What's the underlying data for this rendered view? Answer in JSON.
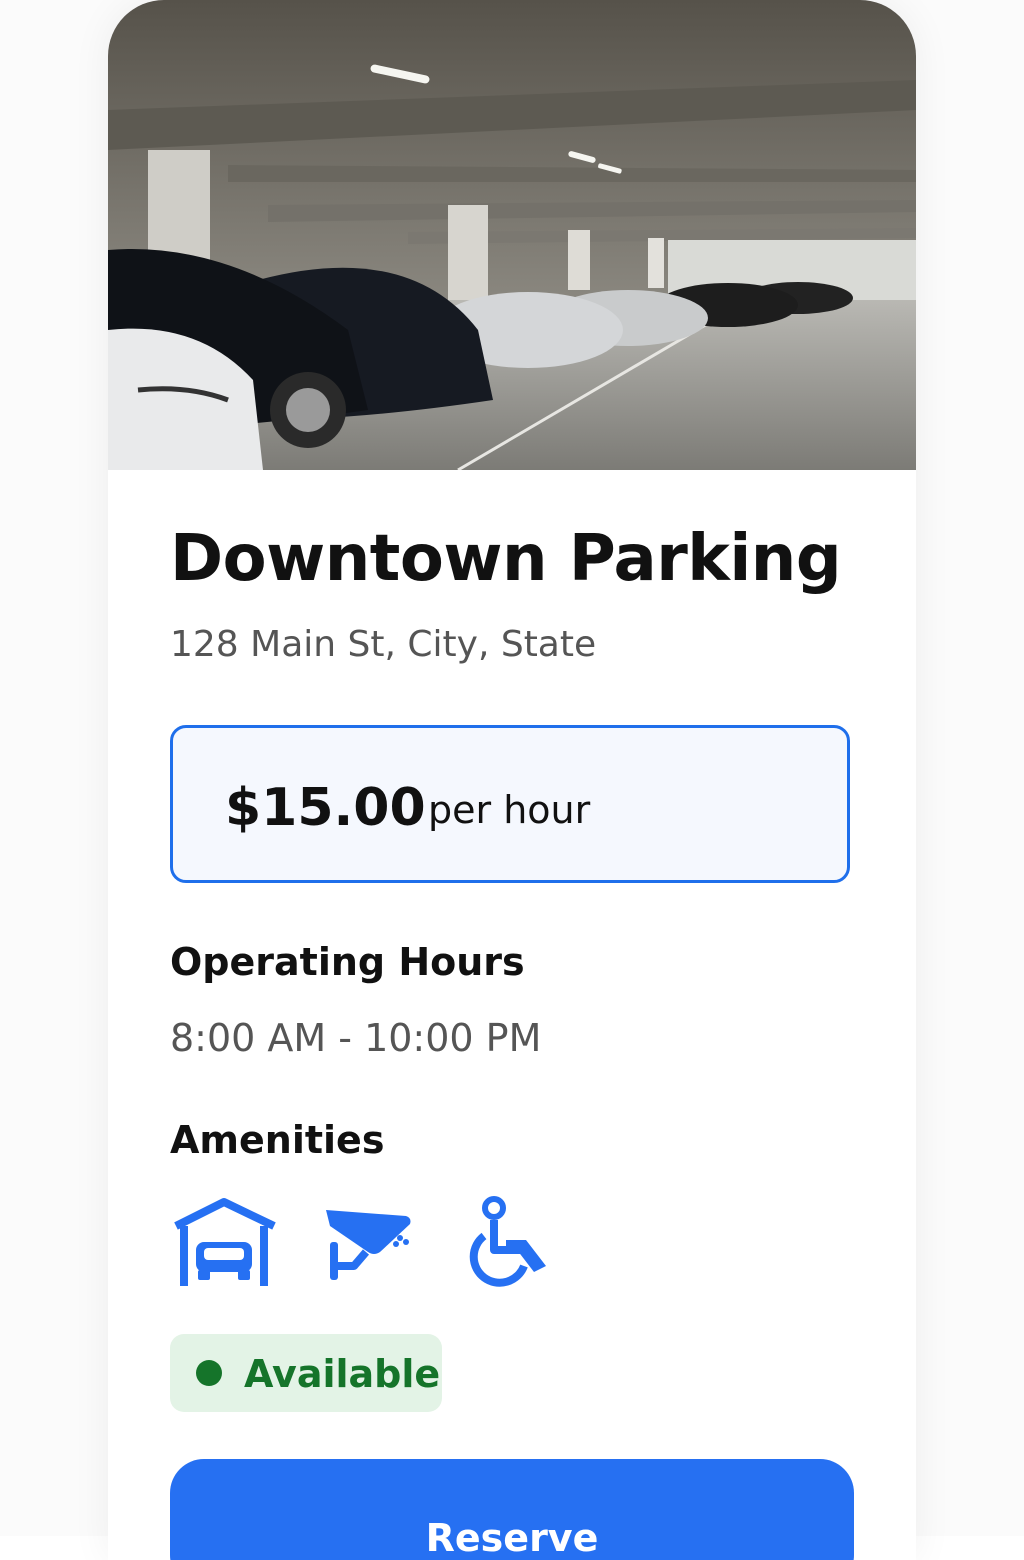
{
  "listing": {
    "name": "Downtown Parking",
    "address": "128 Main St, City, State"
  },
  "pricing": {
    "amount": "$15.00",
    "unit": "per hour"
  },
  "hours": {
    "heading": "Operating Hours",
    "value": "8:00 AM - 10:00 PM"
  },
  "amenities": {
    "heading": "Amenities",
    "icons": [
      "covered-parking-icon",
      "security-camera-icon",
      "wheelchair-accessible-icon"
    ]
  },
  "status": {
    "label": "Available",
    "color": "#15742a",
    "background": "#e3f3e6"
  },
  "action": {
    "reserve_label": "Reserve"
  },
  "theme": {
    "accent": "#2670f2",
    "price_border": "#1f6feb"
  }
}
